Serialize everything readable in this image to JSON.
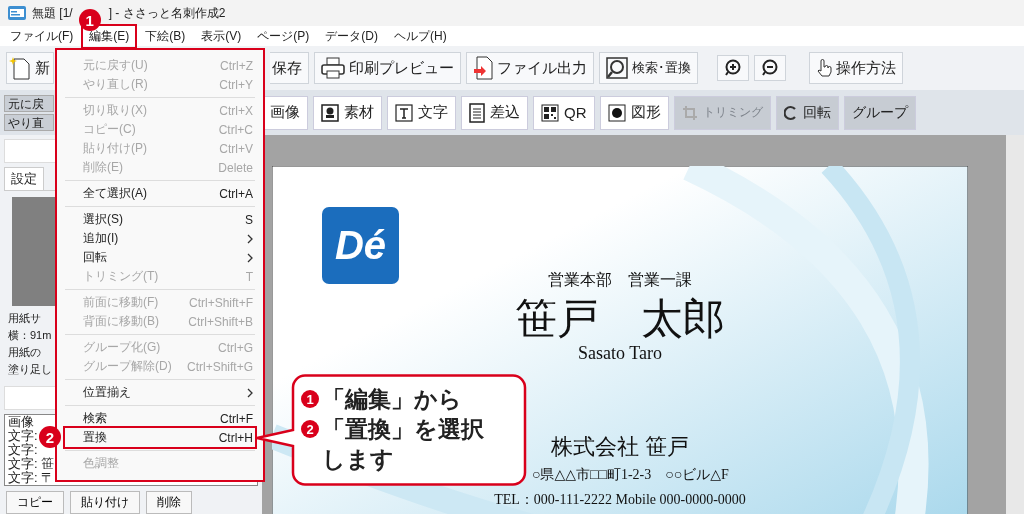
{
  "window": {
    "title_start": "無題 [1/",
    "title_end": "] - ささっと名刺作成2",
    "marker": "1"
  },
  "menu_bar": [
    {
      "label": "ファイル(F)",
      "selected": false
    },
    {
      "label": "編集(E)",
      "selected": true
    },
    {
      "label": "下絵(B)",
      "selected": false
    },
    {
      "label": "表示(V)",
      "selected": false
    },
    {
      "label": "ページ(P)",
      "selected": false
    },
    {
      "label": "データ(D)",
      "selected": false
    },
    {
      "label": "ヘルプ(H)",
      "selected": false
    }
  ],
  "toolbar": [
    {
      "kind": "new",
      "label": "新"
    },
    {
      "kind": "save",
      "label": "保存"
    },
    {
      "kind": "print",
      "label": "印刷プレビュー"
    },
    {
      "kind": "export",
      "label": "ファイル出力"
    },
    {
      "kind": "search",
      "label": "検索･置換"
    },
    {
      "kind": "zoom_in"
    },
    {
      "kind": "zoom_out"
    },
    {
      "kind": "help",
      "label": "操作方法"
    }
  ],
  "history_buttons": [
    "元に戻",
    "やり直"
  ],
  "object_toolbar": [
    {
      "kind": "image",
      "label": "画像",
      "active": true,
      "disabled": false
    },
    {
      "kind": "material",
      "label": "素材",
      "active": true,
      "disabled": false
    },
    {
      "kind": "text",
      "label": "文字",
      "active": true,
      "disabled": false
    },
    {
      "kind": "merge",
      "label": "差込",
      "active": true,
      "disabled": false
    },
    {
      "kind": "qr",
      "label": "QR",
      "active": true,
      "disabled": false
    },
    {
      "kind": "shape",
      "label": "図形",
      "active": true,
      "disabled": false
    },
    {
      "kind": "trim",
      "label": "トリミング",
      "active": false,
      "disabled": true
    },
    {
      "kind": "rotate",
      "label": "回転",
      "active": false,
      "disabled": false
    },
    {
      "kind": "group",
      "label": "グループ",
      "active": false,
      "disabled": false
    }
  ],
  "edit_menu": [
    {
      "kind": "item",
      "label": "元に戻す(U)",
      "shortcut": "Ctrl+Z",
      "disabled": true
    },
    {
      "kind": "item",
      "label": "やり直し(R)",
      "shortcut": "Ctrl+Y",
      "disabled": true
    },
    {
      "kind": "separator"
    },
    {
      "kind": "item",
      "label": "切り取り(X)",
      "shortcut": "Ctrl+X",
      "disabled": true
    },
    {
      "kind": "item",
      "label": "コピー(C)",
      "shortcut": "Ctrl+C",
      "disabled": true
    },
    {
      "kind": "item",
      "label": "貼り付け(P)",
      "shortcut": "Ctrl+V",
      "disabled": true
    },
    {
      "kind": "item",
      "label": "削除(E)",
      "shortcut": "Delete",
      "disabled": true
    },
    {
      "kind": "separator"
    },
    {
      "kind": "item",
      "label": "全て選択(A)",
      "shortcut": "Ctrl+A",
      "disabled": false
    },
    {
      "kind": "separator"
    },
    {
      "kind": "item",
      "label": "選択(S)",
      "shortcut": "S",
      "disabled": false
    },
    {
      "kind": "submenu",
      "label": "追加(I)",
      "disabled": false
    },
    {
      "kind": "submenu",
      "label": "回転",
      "disabled": false
    },
    {
      "kind": "item",
      "label": "トリミング(T)",
      "shortcut": "T",
      "disabled": true
    },
    {
      "kind": "separator"
    },
    {
      "kind": "item",
      "label": "前面に移動(F)",
      "shortcut": "Ctrl+Shift+F",
      "disabled": true
    },
    {
      "kind": "item",
      "label": "背面に移動(B)",
      "shortcut": "Ctrl+Shift+B",
      "disabled": true
    },
    {
      "kind": "separator"
    },
    {
      "kind": "item",
      "label": "グループ化(G)",
      "shortcut": "Ctrl+G",
      "disabled": true
    },
    {
      "kind": "item",
      "label": "グループ解除(D)",
      "shortcut": "Ctrl+Shift+G",
      "disabled": true
    },
    {
      "kind": "separator"
    },
    {
      "kind": "submenu",
      "label": "位置揃え",
      "disabled": false
    },
    {
      "kind": "separator"
    },
    {
      "kind": "item",
      "label": "検索",
      "shortcut": "Ctrl+F",
      "disabled": false
    },
    {
      "kind": "item",
      "label": "置換",
      "shortcut": "Ctrl+H",
      "disabled": false,
      "marker": "2"
    },
    {
      "kind": "separator"
    },
    {
      "kind": "item",
      "label": "色調整",
      "disabled": true
    }
  ],
  "left_panel": {
    "tab": "設定",
    "info": [
      "用紙サ",
      "横：91m",
      "用紙の",
      "塗り足し"
    ],
    "layers": [
      "画像",
      "文字:",
      "文字:",
      "文字: 笹",
      "文字: 〒"
    ],
    "buttons": [
      "コピー",
      "貼り付け",
      "削除"
    ]
  },
  "card": {
    "logo": "Dé",
    "department": "営業本部　営業一課",
    "name": "笹戸　太郎",
    "romaji": "Sasato Taro",
    "company": "株式会社 笹戸",
    "address": "○県△△市□□町1-2-3　○○ビル△F",
    "tel": "TEL：000-111-2222 Mobile 000-0000-0000"
  },
  "callout": [
    {
      "marker": "1",
      "text": "「編集」から"
    },
    {
      "marker": "2",
      "text": "「置換」を選択"
    },
    {
      "text": "します"
    }
  ]
}
